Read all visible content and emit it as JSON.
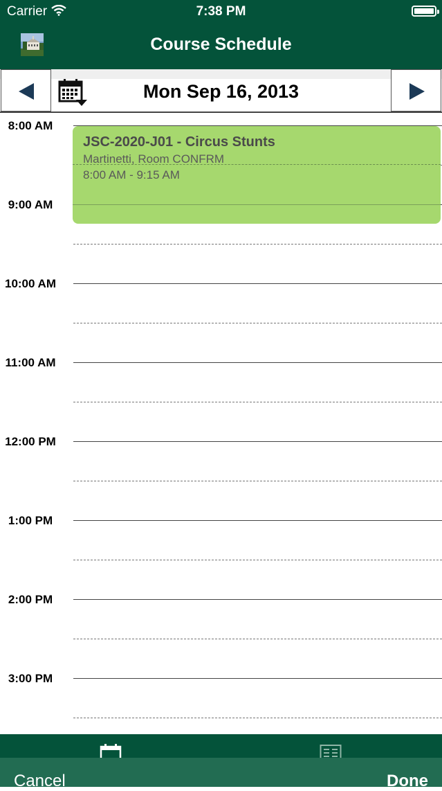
{
  "status": {
    "carrier": "Carrier",
    "time": "7:38 PM"
  },
  "nav": {
    "title": "Course Schedule"
  },
  "datebar": {
    "date": "Mon Sep 16, 2013"
  },
  "schedule": {
    "hours": [
      "8:00 AM",
      "9:00 AM",
      "10:00 AM",
      "11:00 AM",
      "12:00 PM",
      "1:00 PM",
      "2:00 PM",
      "3:00 PM"
    ],
    "event": {
      "title": "JSC-2020-J01 - Circus Stunts",
      "location": "Martinetti, Room CONFRM",
      "time_range": "8:00 AM - 9:15 AM"
    }
  },
  "actions": {
    "cancel": "Cancel",
    "done": "Done"
  },
  "colors": {
    "brand": "#04533a",
    "event": "#a6d86e",
    "arrow": "#1c3a57"
  },
  "icons": [
    "wifi-icon",
    "battery-icon",
    "campus-logo",
    "calendar-picker-icon",
    "prev-arrow-icon",
    "next-arrow-icon",
    "calendar-tab-icon",
    "list-tab-icon"
  ]
}
